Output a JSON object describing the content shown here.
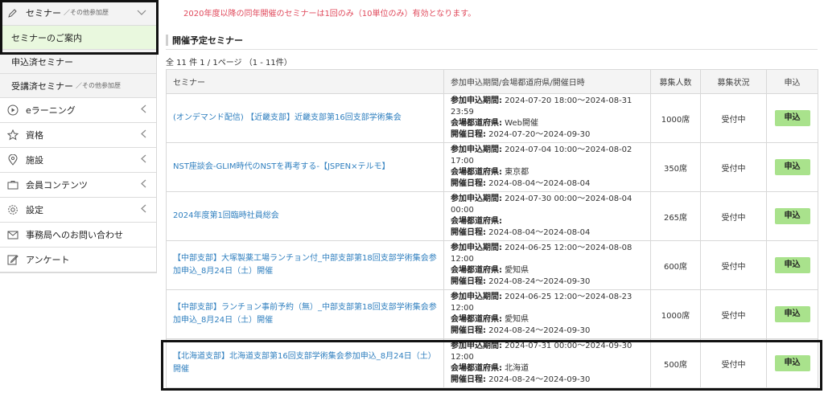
{
  "sidebar": {
    "seminar_header": "セミナー",
    "seminar_header_small": "／その他参加歴",
    "sub_items": [
      {
        "label": "セミナーのご案内",
        "small": ""
      },
      {
        "label": "申込済セミナー",
        "small": ""
      },
      {
        "label": "受講済セミナー",
        "small": "／その他参加歴"
      }
    ],
    "items": [
      {
        "label": "eラーニング"
      },
      {
        "label": "資格"
      },
      {
        "label": "施設"
      },
      {
        "label": "会員コンテンツ"
      },
      {
        "label": "設定"
      },
      {
        "label": "事務局へのお問い合わせ"
      },
      {
        "label": "アンケート"
      }
    ]
  },
  "main": {
    "notice": "2020年度以降の同年開催のセミナーは1回のみ（10単位のみ）有効となります。",
    "section_title": "開催予定セミナー",
    "count": "全 11 件 1 / 1ページ （1 - 11件）",
    "table": {
      "headers": [
        "セミナー",
        "参加申込期間/会場都道府県/開催日時",
        "募集人数",
        "募集状況",
        "申込"
      ],
      "info_labels": {
        "period": "参加申込期間:",
        "pref": "会場都道府県:",
        "date": "開催日程:"
      },
      "rows": [
        {
          "title": "(オンデマンド配信) 【近畿支部】近畿支部第16回支部学術集会",
          "period": " 2024-07-20 18:00～2024-08-31 23:59",
          "pref": " Web開催",
          "date": " 2024-07-20～2024-09-30",
          "capacity": "1000席",
          "status": "受付中",
          "button": "申込"
        },
        {
          "title": "NST座談会-GLIM時代のNSTを再考する-【JSPEN×テルモ】",
          "period": " 2024-07-04 10:00～2024-08-02 17:00",
          "pref": " 東京都",
          "date": " 2024-08-04～2024-08-04",
          "capacity": "350席",
          "status": "受付中",
          "button": "申込"
        },
        {
          "title": "2024年度第1回臨時社員総会",
          "period": " 2024-07-30 00:00～2024-08-04 00:00",
          "pref": "",
          "date": " 2024-08-04～2024-08-04",
          "capacity": "265席",
          "status": "受付中",
          "button": "申込"
        },
        {
          "title": "【中部支部】大塚製薬工場ランチョン付_中部支部第18回支部学術集会参加申込_8月24日（土）開催",
          "period": " 2024-06-25 12:00～2024-08-08 12:00",
          "pref": " 愛知県",
          "date": " 2024-08-24～2024-09-30",
          "capacity": "600席",
          "status": "受付中",
          "button": "申込"
        },
        {
          "title": "【中部支部】ランチョン事前予約（無）_中部支部第18回支部学術集会参加申込_8月24日（土）開催",
          "period": " 2024-06-25 12:00～2024-08-23 12:00",
          "pref": " 愛知県",
          "date": " 2024-08-24～2024-09-30",
          "capacity": "1000席",
          "status": "受付中",
          "button": "申込"
        },
        {
          "title": "【北海道支部】北海道支部第16回支部学術集会参加申込_8月24日（土）開催",
          "period": " 2024-07-31 00:00～2024-09-30 12:00",
          "pref": " 北海道",
          "date": " 2024-08-24～2024-09-30",
          "capacity": "500席",
          "status": "受付中",
          "button": "申込"
        }
      ]
    }
  },
  "colors": {
    "accent_green": "#a9e28c",
    "notice_red": "#e04a5c",
    "link_blue": "#2f7fbf",
    "active_bg": "#e9f8de"
  }
}
